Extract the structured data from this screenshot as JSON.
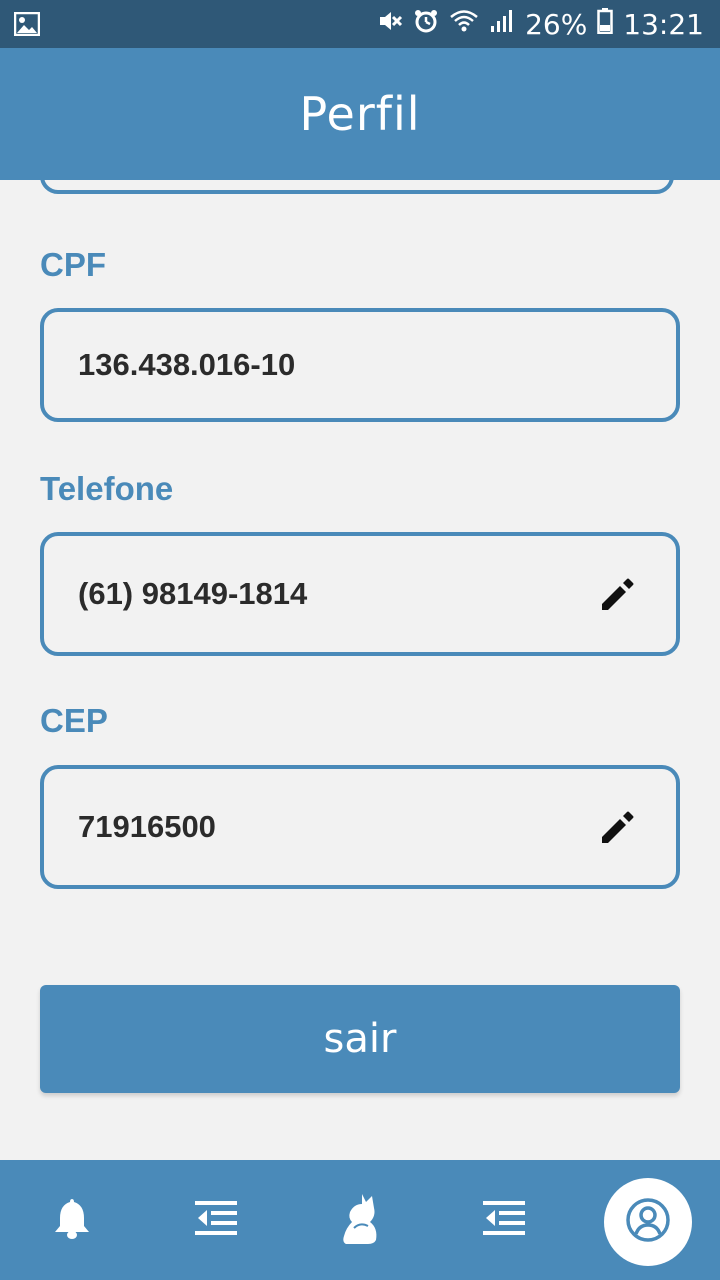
{
  "status_bar": {
    "battery": "26%",
    "time": "13:21",
    "icons": [
      "gallery-icon",
      "mute-icon",
      "alarm-icon",
      "wifi-icon",
      "signal-icon",
      "battery-icon"
    ]
  },
  "header": {
    "title": "Perfil"
  },
  "fields": {
    "cpf": {
      "label": "CPF",
      "value": "136.438.016-10",
      "editable": false
    },
    "telefone": {
      "label": "Telefone",
      "value": "(61) 98149-1814",
      "editable": true
    },
    "cep": {
      "label": "CEP",
      "value": "71916500",
      "editable": true
    }
  },
  "logout_button": {
    "label": "sair"
  },
  "bottom_nav": {
    "items": [
      "bell-icon",
      "list-icon",
      "cat-icon",
      "list-icon",
      "profile-icon"
    ],
    "active": "profile-icon"
  },
  "colors": {
    "primary": "#4a8ab9",
    "status_bar": "#2f5877",
    "background": "#f2f2f2",
    "text": "#2b2b2b"
  }
}
